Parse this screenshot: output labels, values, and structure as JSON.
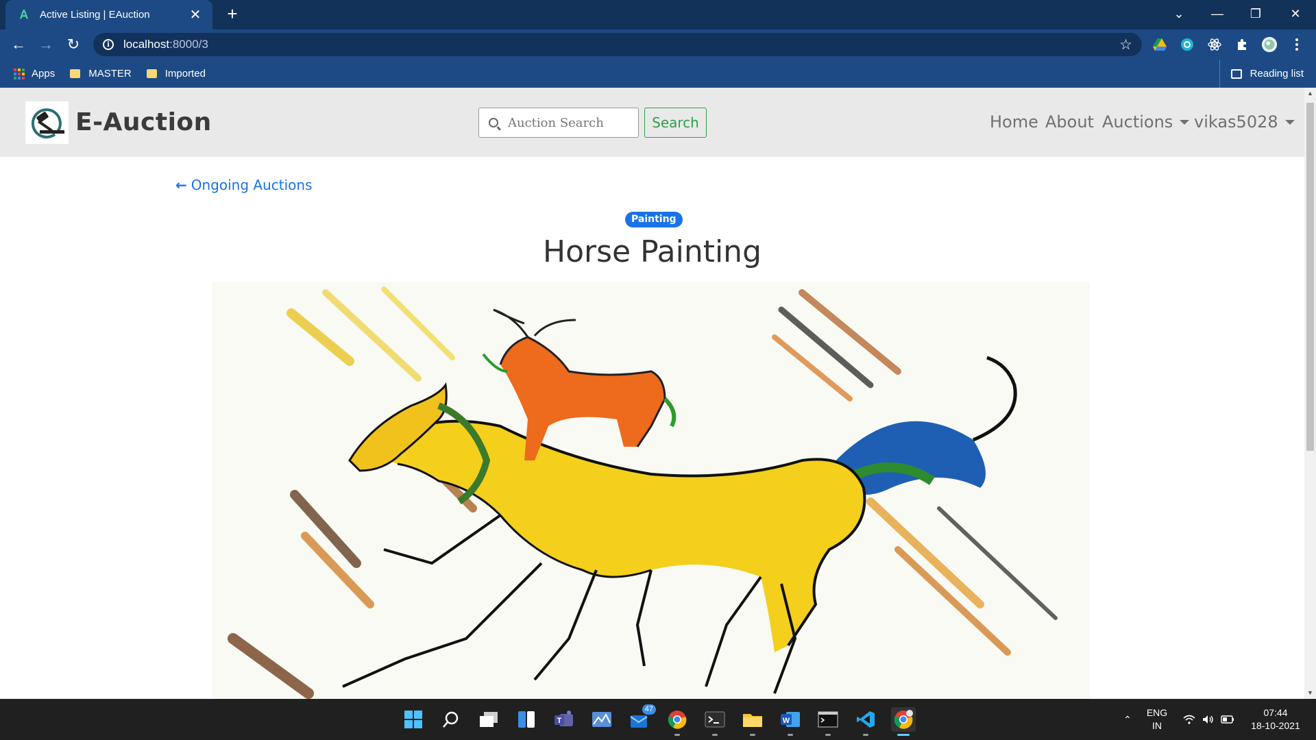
{
  "browser": {
    "tab_title": "Active Listing | EAuction",
    "url_host": "localhost",
    "url_path": ":8000/3",
    "bookmarks": [
      {
        "label": "Apps"
      },
      {
        "label": "MASTER"
      },
      {
        "label": "Imported"
      }
    ],
    "reading_list": "Reading list"
  },
  "site": {
    "brand": "E-Auction",
    "search_placeholder": "Auction Search",
    "search_button": "Search",
    "menu": {
      "home": "Home",
      "about": "About",
      "auctions": "Auctions",
      "user": "vikas5028"
    }
  },
  "listing": {
    "back_link": "Ongoing Auctions",
    "category": "Painting",
    "title": "Horse Painting"
  },
  "taskbar": {
    "mail_badge": "47",
    "lang_top": "ENG",
    "lang_bottom": "IN",
    "time": "07:44",
    "date": "18-10-2021"
  },
  "colors": {
    "tabstrip": "#13325a",
    "toolbar": "#1d4a84",
    "link": "#1a73e8",
    "search_green": "#2aa04a",
    "navbar_bg": "#e9e9e9"
  }
}
